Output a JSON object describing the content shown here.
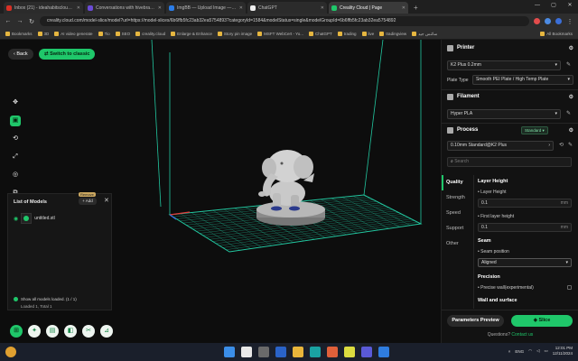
{
  "browser": {
    "tabs": [
      {
        "label": "Inbox (21) - ideahabitscloud@…",
        "color": "#d93025",
        "active": false
      },
      {
        "label": "Conversations with hivebrand - C…",
        "color": "#6b4bd6",
        "active": false
      },
      {
        "label": "ImgBB — Upload Image — Free…",
        "color": "#2b7de9",
        "active": false
      },
      {
        "label": "ChatGPT",
        "color": "#eeeeee",
        "active": false
      },
      {
        "label": "Creality Cloud | Page",
        "color": "#1fc76a",
        "active": true
      }
    ],
    "url": "creality.cloud.com/model-slice/model?url=https://model-slices/6b6ffb5fc23ab32ea5754893?categoryId=1584&modelStatus=single&modelGroupId=6b6ffb5fc23ab32ea5754892",
    "bookmarks": [
      "Bookmarks",
      "3D",
      "AI video generate",
      "Tio",
      "SEO",
      "creality.cloud",
      "Enlarge & Enhance",
      "Story pin image",
      "MSFT WebCert - Yo...",
      "ChatGPT",
      "trading",
      "live",
      "tradingview",
      "سائنس جید"
    ],
    "bookmarks_right": "All Bookmarks"
  },
  "toolbar": {
    "back_label": "Back",
    "classic_label": "Switch to classic"
  },
  "models_panel": {
    "title": "List of Models",
    "remove_tip": "Remove",
    "add_label": "+ Add",
    "model_name": "untitled.stl",
    "status": "Show all models loaded. (1 / 1)",
    "loaded": "Loaded 1, Total 1"
  },
  "printer": {
    "title": "Printer",
    "model": "K2 Plus 0.2mm",
    "plate_label": "Plate Type",
    "plate_value": "Smooth PEI Plate / High Temp Plate"
  },
  "filament": {
    "title": "Filament",
    "value": "Hyper PLA"
  },
  "process": {
    "title": "Process",
    "mode": "Standard",
    "preset": "0.10mm Standard@K2 Plus",
    "search_placeholder": "Search"
  },
  "settings_tabs": [
    "Quality",
    "Strength",
    "Speed",
    "Support",
    "Other"
  ],
  "quality": {
    "layer_height_header": "Layer Height",
    "layer_height_label": "Layer Height",
    "layer_height_value": "0.1",
    "first_layer_label": "First layer height",
    "first_layer_value": "0.1",
    "unit": "mm",
    "seam_header": "Seam",
    "seam_position_label": "Seam position",
    "seam_position_value": "Aligned",
    "precision_header": "Precision",
    "precise_wall_label": "Precise wall(experimental)",
    "walls_header": "Wall and surface"
  },
  "footer": {
    "preview_label": "Parameters Preview",
    "slice_label": "Slice",
    "contact_text": "Questions?",
    "contact_link": "Contact us"
  },
  "taskbar": {
    "lang": "ENG",
    "time": "12:01 PM",
    "date": "12/11/2024"
  },
  "colors": {
    "accent": "#1fc76a",
    "bed_grid": "#22c7a0",
    "background": "#0d0d0d"
  }
}
